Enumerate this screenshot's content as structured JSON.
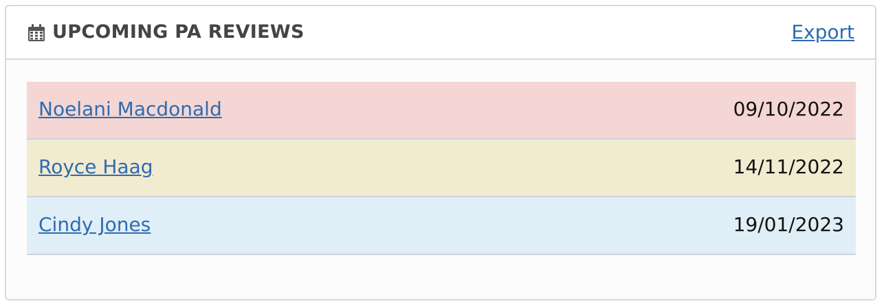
{
  "panel": {
    "icon": "calendar-icon",
    "title": "UPCOMING PA REVIEWS",
    "export_label": "Export"
  },
  "reviews": [
    {
      "name": "Noelani Macdonald",
      "date": "09/10/2022",
      "status_color": "#f4d6d4"
    },
    {
      "name": "Royce Haag",
      "date": "14/11/2022",
      "status_color": "#f1ebd0"
    },
    {
      "name": "Cindy Jones",
      "date": "19/01/2023",
      "status_color": "#e0eef7"
    }
  ],
  "colors": {
    "link": "#2e6bb0",
    "title": "#444444"
  }
}
